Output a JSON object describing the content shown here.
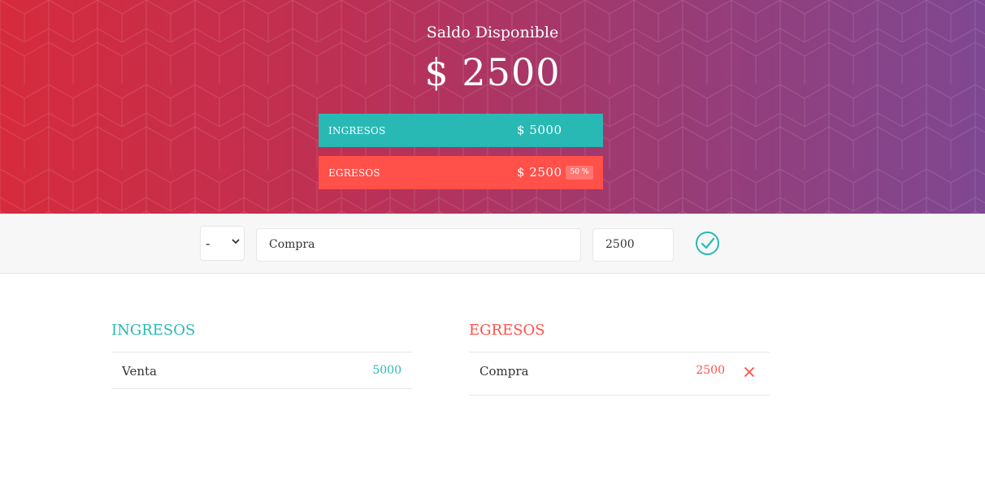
{
  "header": {
    "title": "Saldo Disponible",
    "balance": "$ 2500"
  },
  "summary": {
    "income": {
      "label": "INGRESOS",
      "value": "$ 5000",
      "color": "#28b9b5"
    },
    "expenses": {
      "label": "EGRESOS",
      "value": "$ 2500",
      "percentage": "50 %",
      "color": "#ff5049"
    }
  },
  "form": {
    "type_selected": "-",
    "type_options": [
      "+",
      "-"
    ],
    "description_value": "Compra",
    "value_value": "2500",
    "submit_icon": "check-circle-icon"
  },
  "income_list": {
    "title": "INGRESOS",
    "items": [
      {
        "description": "Venta",
        "value": "5000"
      }
    ]
  },
  "expense_list": {
    "title": "EGRESOS",
    "items": [
      {
        "description": "Compra",
        "value": "2500",
        "delete_icon": "close-icon"
      }
    ]
  },
  "colors": {
    "gradient_start": "#d62b3c",
    "gradient_end": "#7e4892",
    "income": "#28b9b5",
    "expense": "#ff5049"
  }
}
